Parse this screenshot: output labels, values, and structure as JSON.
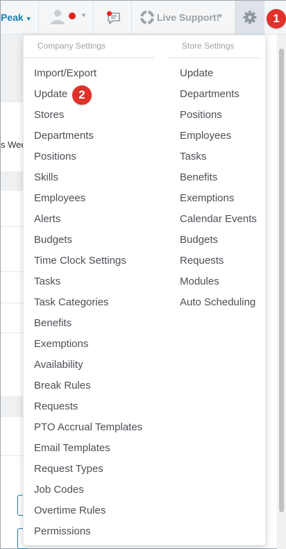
{
  "header": {
    "brand_label": "Peak",
    "support_label": "Live Support!"
  },
  "background": {
    "week_text": "s Wee"
  },
  "dropdown": {
    "company_heading": "Company Settings",
    "store_heading": "Store Settings",
    "company_items": [
      "Import/Export",
      "Update",
      "Stores",
      "Departments",
      "Positions",
      "Skills",
      "Employees",
      "Alerts",
      "Budgets",
      "Time Clock Settings",
      "Tasks",
      "Task Categories",
      "Benefits",
      "Exemptions",
      "Availability",
      "Break Rules",
      "Requests",
      "PTO Accrual Templates",
      "Email Templates",
      "Request Types",
      "Job Codes",
      "Overtime Rules",
      "Permissions"
    ],
    "store_items": [
      "Update",
      "Departments",
      "Positions",
      "Employees",
      "Tasks",
      "Benefits",
      "Exemptions",
      "Calendar Events",
      "Budgets",
      "Requests",
      "Modules",
      "Auto Scheduling"
    ]
  },
  "annotations": {
    "step1": "1",
    "step2": "2"
  },
  "colors": {
    "accent": "#1a7fb5",
    "notification": "#e8231f",
    "badge": "#e0312a"
  },
  "icons": {
    "user": "user-avatar-icon",
    "chat": "chat-icon",
    "support": "lifebuoy-icon",
    "settings": "gear-icon"
  }
}
